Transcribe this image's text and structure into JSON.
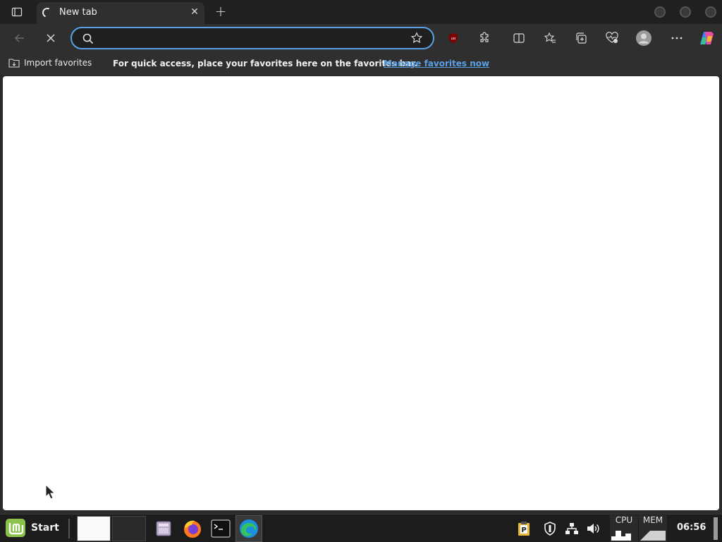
{
  "tab": {
    "title": "New tab",
    "close": "✕"
  },
  "new_tab": "+",
  "address": {
    "value": "",
    "placeholder": ""
  },
  "favorites_bar": {
    "import_label": "Import favorites",
    "message": "For quick access, place your favorites here on the favorites bar.",
    "link": "Manage favorites now"
  },
  "taskbar": {
    "start_label": "Start",
    "cpu_label": "CPU",
    "mem_label": "MEM",
    "clock": "06:56"
  },
  "colors": {
    "accent": "#5aa0e6",
    "ublock": "#800000"
  }
}
